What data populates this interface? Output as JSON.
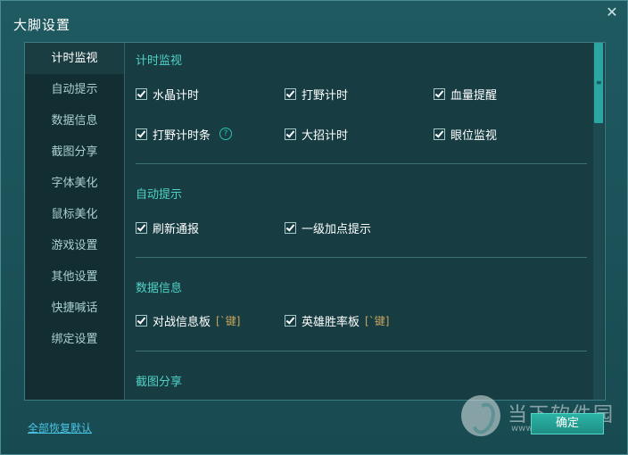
{
  "window": {
    "title": "大脚设置",
    "close_glyph": "✕"
  },
  "sidebar": {
    "items": [
      {
        "label": "计时监视"
      },
      {
        "label": "自动提示"
      },
      {
        "label": "数据信息"
      },
      {
        "label": "截图分享"
      },
      {
        "label": "字体美化"
      },
      {
        "label": "鼠标美化"
      },
      {
        "label": "游戏设置"
      },
      {
        "label": "其他设置"
      },
      {
        "label": "快捷喊话"
      },
      {
        "label": "绑定设置"
      }
    ]
  },
  "sections": {
    "timer": {
      "title": "计时监视",
      "options": [
        {
          "label": "水晶计时",
          "checked": true
        },
        {
          "label": "打野计时",
          "checked": true
        },
        {
          "label": "血量提醒",
          "checked": true
        },
        {
          "label": "打野计时条",
          "checked": true,
          "help": "?"
        },
        {
          "label": "大招计时",
          "checked": true
        },
        {
          "label": "眼位监视",
          "checked": true
        }
      ]
    },
    "auto": {
      "title": "自动提示",
      "options": [
        {
          "label": "刷新通报",
          "checked": true
        },
        {
          "label": "一级加点提示",
          "checked": true
        }
      ]
    },
    "data": {
      "title": "数据信息",
      "options": [
        {
          "label": "对战信息板",
          "checked": true,
          "hotkey": "[`键]"
        },
        {
          "label": "英雄胜率板",
          "checked": true,
          "hotkey": "[`键]"
        }
      ]
    },
    "screenshot": {
      "title": "截图分享"
    }
  },
  "footer": {
    "restore_label": "全部恢复默认",
    "ok_label": "确定"
  },
  "watermark": {
    "cn": "当下软件园",
    "url": "www.downxia.com"
  },
  "colors": {
    "accent": "#4fd2c6",
    "hotkey": "#c9a45c",
    "link": "#4bc4e6"
  }
}
